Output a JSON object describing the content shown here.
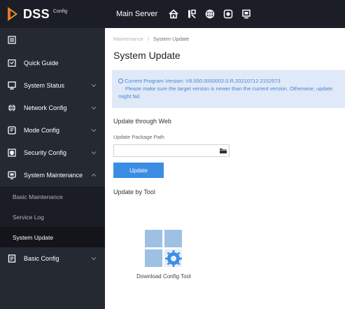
{
  "brand": {
    "name": "DSS",
    "sub": "Config"
  },
  "header": {
    "server_label": "Main Server"
  },
  "top_icons": [
    "home-icon",
    "rack-icon",
    "globe-icon",
    "record-icon",
    "monitor-icon"
  ],
  "sidebar": {
    "items": [
      {
        "label": "Quick Guide",
        "icon": "quick-guide-icon"
      },
      {
        "label": "System Status",
        "icon": "monitor-icon"
      },
      {
        "label": "Network Config",
        "icon": "globe-icon"
      },
      {
        "label": "Mode Config",
        "icon": "mode-icon"
      },
      {
        "label": "Security Config",
        "icon": "shield-icon"
      },
      {
        "label": "System Maintenance",
        "icon": "maintenance-icon",
        "expanded": true,
        "children": [
          {
            "label": "Basic Maintenance"
          },
          {
            "label": "Service Log"
          },
          {
            "label": "System Update",
            "active": true
          }
        ]
      },
      {
        "label": "Basic Config",
        "icon": "document-icon"
      }
    ]
  },
  "breadcrumb": {
    "parent": "Maintenance",
    "separator": "/",
    "current": "System Update"
  },
  "page": {
    "title": "System Update"
  },
  "notice": {
    "line1": "Current Program Version: V8.000.0000002.0.R.20210712.2152573",
    "line2": "Please make sure the target version is newer than the current version. Otherwise, update might fail."
  },
  "web_update": {
    "heading": "Update through Web",
    "path_label": "Update Package Path",
    "path_value": "",
    "path_placeholder": "",
    "button_label": "Update"
  },
  "tool_update": {
    "heading": "Update by Tool",
    "tool_label": "Download Config Tool"
  },
  "colors": {
    "topbar": "#1b1e26",
    "sidebar": "#252932",
    "submenu": "#1a1d24",
    "accent": "#3b8de4",
    "notice_bg": "#dfe9f8",
    "notice_text": "#4a86d2"
  }
}
